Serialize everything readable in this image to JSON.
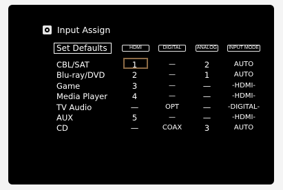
{
  "header": {
    "icon": "input-source-icon",
    "title": "Input Assign"
  },
  "set_defaults_label": "Set Defaults",
  "columns": [
    "HDMI",
    "DIGITAL",
    "ANALOG",
    "INPUT MODE"
  ],
  "rows": [
    {
      "name": "CBL/SAT",
      "hdmi": "1",
      "digital": "—",
      "analog": "2",
      "mode": "AUTO"
    },
    {
      "name": "Blu-ray/DVD",
      "hdmi": "2",
      "digital": "—",
      "analog": "1",
      "mode": "AUTO"
    },
    {
      "name": "Game",
      "hdmi": "3",
      "digital": "—",
      "analog": "—",
      "mode": "-HDMI-"
    },
    {
      "name": "Media Player",
      "hdmi": "4",
      "digital": "—",
      "analog": "—",
      "mode": "-HDMI-"
    },
    {
      "name": "TV Audio",
      "hdmi": "—",
      "digital": "OPT",
      "analog": "—",
      "mode": "-DIGITAL-"
    },
    {
      "name": "AUX",
      "hdmi": "5",
      "digital": "—",
      "analog": "—",
      "mode": "-HDMI-"
    },
    {
      "name": "CD",
      "hdmi": "—",
      "digital": "COAX",
      "analog": "3",
      "mode": "AUTO"
    }
  ],
  "colors": {
    "background": "#000000",
    "text": "#ffffff",
    "cursor": "#8b6a45"
  }
}
